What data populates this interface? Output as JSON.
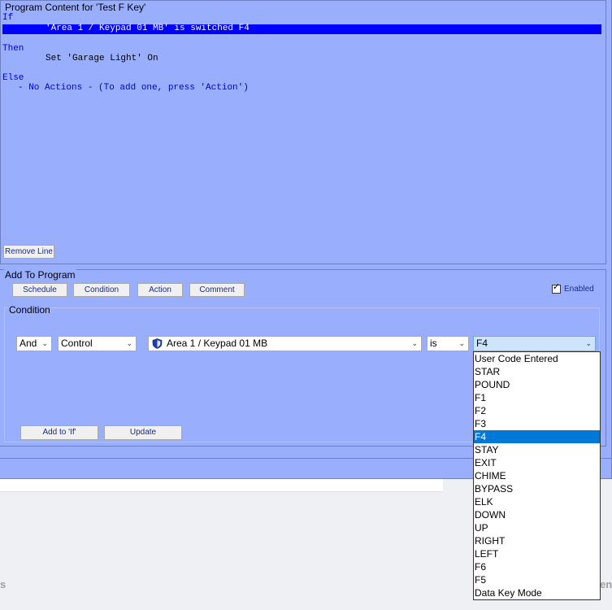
{
  "program": {
    "title": "Program Content for 'Test F Key'",
    "if_kw": "If",
    "condition_line": "'Area 1 / Keypad 01 MB' is switched F4",
    "then_kw": "Then",
    "then_action": "Set 'Garage Light' On",
    "else_kw": "Else",
    "else_action": "- No Actions - (To add one, press 'Action')",
    "remove_line_label": "Remove Line"
  },
  "add_to_program": {
    "title": "Add To Program",
    "buttons": [
      "Schedule",
      "Condition",
      "Action",
      "Comment"
    ],
    "enabled_label": "Enabled",
    "enabled_checked": "✓",
    "condition_title": "Condition",
    "andor_value": "And",
    "type_value": "Control",
    "device_value": "Area 1 / Keypad 01 MB",
    "operator_value": "is",
    "key_value": "F4",
    "add_if_label": "Add to 'If'",
    "update_label": "Update"
  },
  "dropdown": {
    "options": [
      "User Code Entered",
      "STAR",
      "POUND",
      "F1",
      "F2",
      "F3",
      "F4",
      "STAY",
      "EXIT",
      "CHIME",
      "BYPASS",
      "ELK",
      "DOWN",
      "UP",
      "RIGHT",
      "LEFT",
      "F6",
      "F5",
      "Data Key Mode"
    ],
    "selected": "F4"
  },
  "background": {
    "left_text": "s",
    "right_text": "en"
  },
  "colors": {
    "panel": "#9aaefe",
    "highlight": "#0000ff",
    "dropdown_selection": "#0078d7",
    "keyword": "#0000cc"
  },
  "icons": {
    "device": "shield-icon",
    "chevron": "chevron-down-icon"
  }
}
